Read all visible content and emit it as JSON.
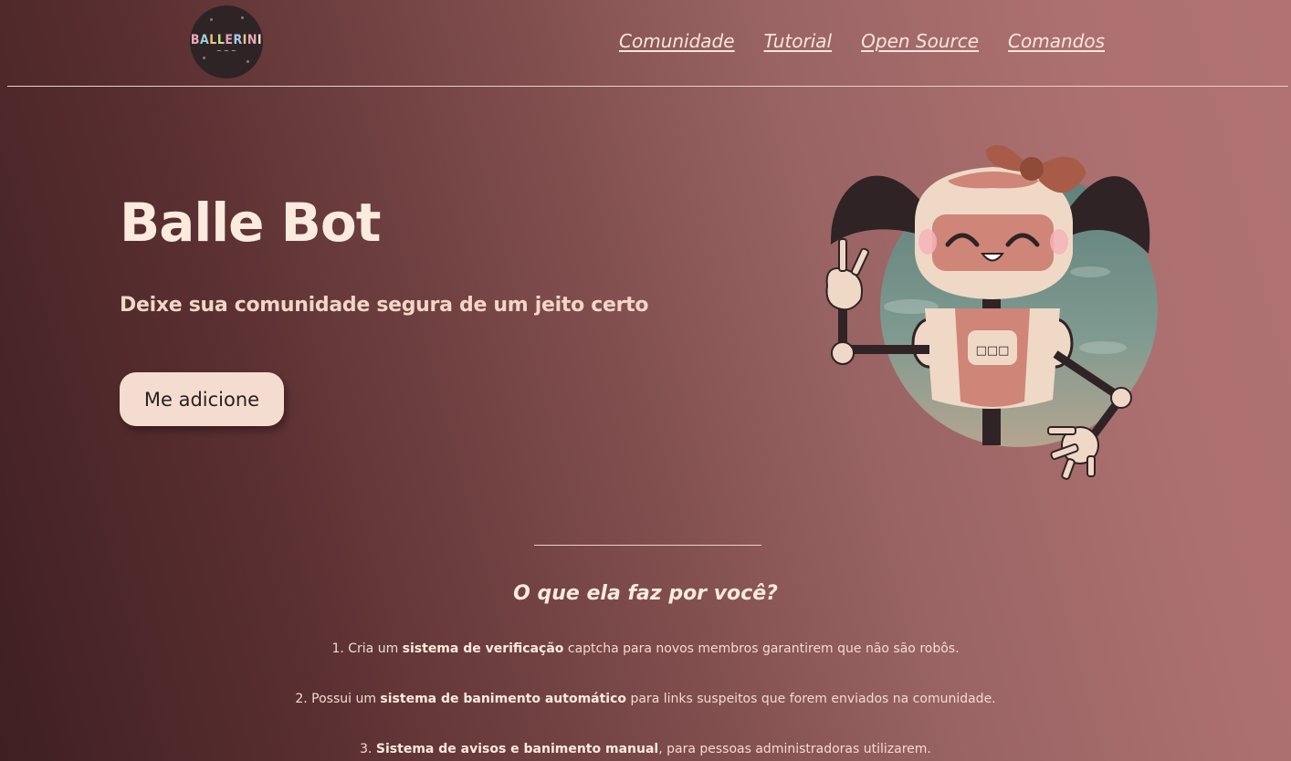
{
  "logo": {
    "text": "BALLERINI",
    "signature": "~ ~ ~"
  },
  "nav": {
    "links": [
      "Comunidade",
      "Tutorial",
      "Open Source",
      "Comandos"
    ]
  },
  "hero": {
    "title": "Balle Bot",
    "subtitle": "Deixe sua comunidade segura de um jeito certo",
    "button_label": "Me adicione"
  },
  "illustration": {
    "name": "robot-girl-illustration",
    "chest_display": "□□□"
  },
  "features": {
    "title": "O que ela faz por você?",
    "items": [
      {
        "prefix": "1. Cria um ",
        "bold": "sistema de verificação",
        "suffix": " captcha para novos membros garantirem que não são robôs."
      },
      {
        "prefix": "2. Possui um ",
        "bold": "sistema de banimento automático",
        "suffix": " para links suspeitos que forem enviados na comunidade."
      },
      {
        "prefix": "3. ",
        "bold": "Sistema de avisos e banimento manual",
        "suffix": ", para pessoas administradoras utilizarem."
      }
    ]
  },
  "colors": {
    "background_dark": "#3f1f21",
    "background_light": "#b07272",
    "text": "#fbeade",
    "button_bg": "#f4ddd0",
    "button_text": "#2a1f22"
  }
}
